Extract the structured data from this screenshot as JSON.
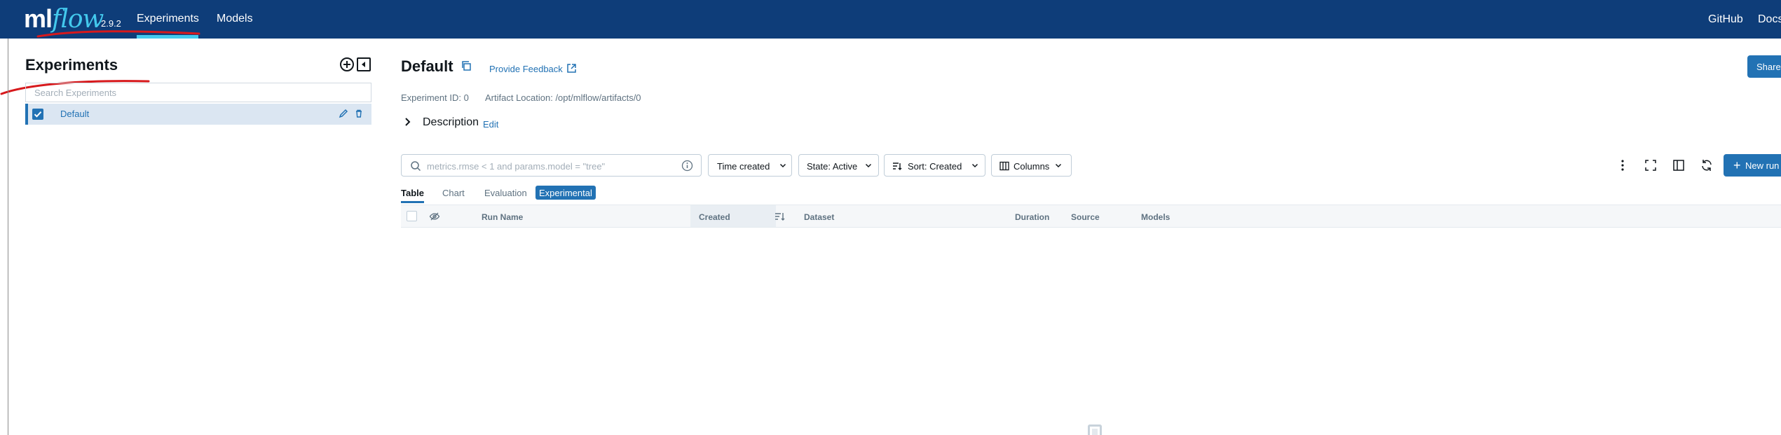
{
  "header": {
    "logo_ml": "ml",
    "logo_flow": "flow",
    "version": "2.9.2",
    "nav": [
      "Experiments",
      "Models"
    ],
    "right_links": [
      "GitHub",
      "Docs"
    ]
  },
  "sidebar": {
    "title": "Experiments",
    "search_placeholder": "Search Experiments",
    "experiments": [
      {
        "name": "Default",
        "selected": true
      }
    ]
  },
  "main": {
    "title": "Default",
    "feedback_link": "Provide Feedback",
    "share_button": "Share",
    "experiment_id": "Experiment ID: 0",
    "artifact_location": "Artifact Location: /opt/mlflow/artifacts/0",
    "description_label": "Description",
    "description_edit": "Edit"
  },
  "controls": {
    "search_placeholder": "metrics.rmse < 1 and params.model = \"tree\"",
    "time_filter": "Time created",
    "state_filter": "State: Active",
    "sort": "Sort: Created",
    "columns": "Columns",
    "new_run": "New run"
  },
  "tabs": [
    "Table",
    "Chart",
    "Evaluation"
  ],
  "experimental_badge": "Experimental",
  "grid": {
    "columns": [
      "Run Name",
      "Created",
      "Dataset",
      "Duration",
      "Source",
      "Models"
    ]
  },
  "colors": {
    "header_bg": "#0e3d79",
    "accent": "#2272b4",
    "selected_row": "#dbe6f2",
    "annotation": "#d7191c"
  },
  "icons": [
    "add-experiment-icon",
    "collapse-sidebar-icon",
    "checkbox-icon",
    "edit-icon",
    "trash-icon",
    "copy-icon",
    "external-link-icon",
    "chevron-right-icon",
    "search-icon",
    "info-icon",
    "chevron-down-icon",
    "sort-icon",
    "columns-icon",
    "kebab-menu-icon",
    "fullscreen-icon",
    "sidebar-toggle-icon",
    "refresh-icon",
    "plus-icon",
    "eye-off-icon"
  ]
}
